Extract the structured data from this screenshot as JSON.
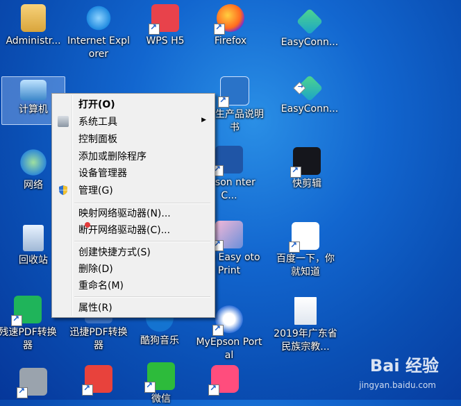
{
  "desktop": {
    "icons": [
      {
        "label": "Administr..."
      },
      {
        "label": "Internet Explorer"
      },
      {
        "label": "WPS H5"
      },
      {
        "label": "Firefox"
      },
      {
        "label": "EasyConn..."
      },
      {
        "label": "计算机"
      },
      {
        "label": "借生产品说明书"
      },
      {
        "label": "EasyConn..."
      },
      {
        "label": "网络"
      },
      {
        "label": "Epson nter C..."
      },
      {
        "label": "快剪辑"
      },
      {
        "label": "回收站"
      },
      {
        "label": "son Easy oto Print"
      },
      {
        "label": "百度一下，你就知道"
      },
      {
        "label": "残速PDF转换器"
      },
      {
        "label": "迅捷PDF转换器"
      },
      {
        "label": "酷狗音乐"
      },
      {
        "label": "MyEpson Portal"
      },
      {
        "label": "2019年广东省民族宗教..."
      },
      {
        "label": "微信"
      }
    ]
  },
  "context_menu": {
    "items": [
      {
        "label": "打开(O)"
      },
      {
        "label": "系统工具"
      },
      {
        "label": "控制面板"
      },
      {
        "label": "添加或删除程序"
      },
      {
        "label": "设备管理器"
      },
      {
        "label": "管理(G)"
      },
      {
        "label": "映射网络驱动器(N)..."
      },
      {
        "label": "断开网络驱动器(C)..."
      },
      {
        "label": "创建快捷方式(S)"
      },
      {
        "label": "删除(D)"
      },
      {
        "label": "重命名(M)"
      },
      {
        "label": "属性(R)"
      }
    ],
    "submenu_arrow": "▶"
  },
  "watermark": {
    "brand": "Bai 经验",
    "url": "jingyan.baidu.com"
  },
  "colors": {
    "desktop_bg": "#1266cf",
    "menu_bg": "#f0f0f0"
  }
}
